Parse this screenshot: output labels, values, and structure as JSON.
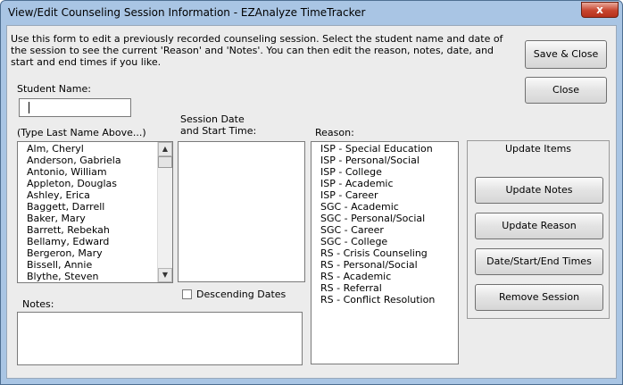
{
  "window": {
    "title": "View/Edit Counseling Session Information - EZAnalyze TimeTracker",
    "close_glyph": "x"
  },
  "description": "Use this form to edit a previously recorded counseling session.  Select the student name and date of the session to see the current 'Reason' and 'Notes'.  You can then edit the reason, notes, date, and start and end times if you like.",
  "buttons": {
    "save_close": "Save & Close",
    "close": "Close",
    "update_notes": "Update Notes",
    "update_reason": "Update Reason",
    "date_times": "Date/Start/End Times",
    "remove_session": "Remove Session"
  },
  "student_name": {
    "label": "Student Name:",
    "value": ""
  },
  "student_list": {
    "label": "(Type Last Name Above...)",
    "items": [
      "Alm, Cheryl",
      "Anderson, Gabriela",
      "Antonio, William",
      "Appleton, Douglas",
      "Ashley, Erica",
      "Baggett, Darrell",
      "Baker, Mary",
      "Barrett, Rebekah",
      "Bellamy, Edward",
      "Bergeron, Mary",
      "Bissell, Annie",
      "Blythe, Steven"
    ]
  },
  "session": {
    "label_line1": "Session Date",
    "label_line2": "and Start Time:",
    "items": []
  },
  "descending": {
    "label": "Descending Dates",
    "checked": false
  },
  "reason": {
    "label": "Reason:",
    "items": [
      "ISP - Special Education",
      "ISP - Personal/Social",
      "ISP - College",
      "ISP - Academic",
      "ISP - Career",
      "SGC - Academic",
      "SGC - Personal/Social",
      "SGC - Career",
      "SGC - College",
      "RS - Crisis Counseling",
      "RS - Personal/Social",
      "RS - Academic",
      "RS - Referral",
      "RS - Conflict Resolution"
    ]
  },
  "update_group": {
    "label": "Update Items"
  },
  "notes": {
    "label": "Notes:",
    "value": ""
  }
}
